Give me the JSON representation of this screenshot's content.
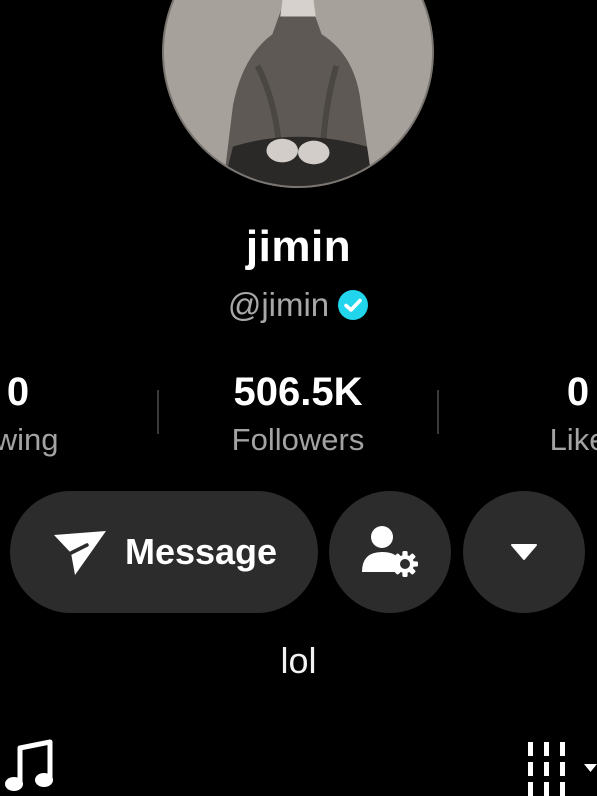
{
  "profile": {
    "name": "jimin",
    "handle": "@jimin",
    "verified": true,
    "avatar_icon": "profile-photo-bw",
    "bio": "lol"
  },
  "stats": {
    "following": {
      "value": "0",
      "label": "owing"
    },
    "followers": {
      "value": "506.5K",
      "label": "Followers"
    },
    "likes": {
      "value": "0",
      "label": "Like"
    }
  },
  "actions": {
    "message_label": "Message",
    "message_icon": "send-icon",
    "friend_settings_icon": "user-gear-icon",
    "more_icon": "caret-down-icon"
  },
  "colors": {
    "background": "#000000",
    "button": "#2c2c2c",
    "secondary_text": "#a8a8a8",
    "verified": "#20d5ec"
  },
  "bottom_icons": [
    "music-note-icon",
    "grid-icon"
  ]
}
